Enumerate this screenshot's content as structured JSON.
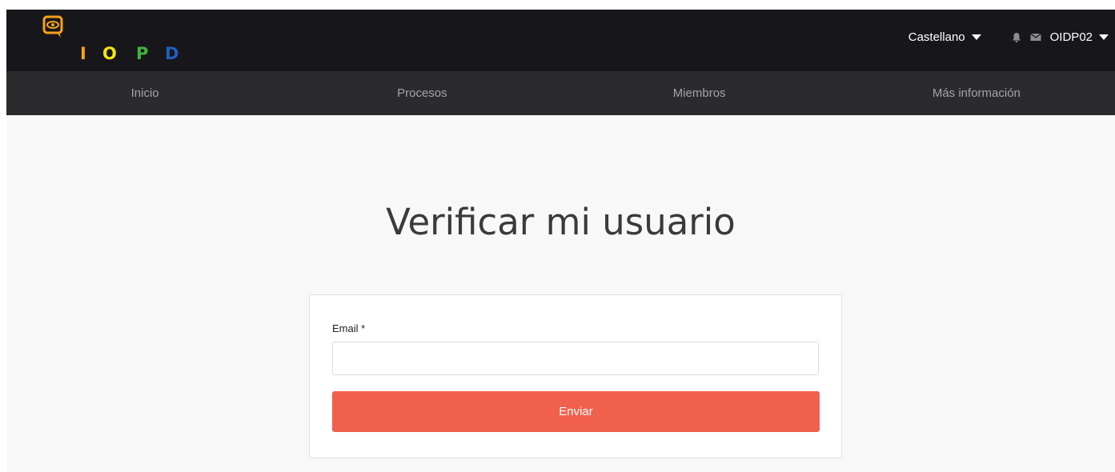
{
  "brand": {
    "letters": [
      "I",
      "O",
      "P",
      "D"
    ],
    "letter_colors": [
      "#f7a21b",
      "#f3e516",
      "#41b33b",
      "#1f5fbf"
    ],
    "icon": "eye-speech-bubble-icon",
    "icon_color": "#f7a21b"
  },
  "header": {
    "language": "Castellano",
    "notifications_icon": "bell-icon",
    "messages_icon": "envelope-icon",
    "username": "OIDP02"
  },
  "nav": {
    "items": [
      {
        "label": "Inicio"
      },
      {
        "label": "Procesos"
      },
      {
        "label": "Miembros"
      },
      {
        "label": "Más información"
      }
    ]
  },
  "main": {
    "title": "Verificar mi usuario",
    "form": {
      "email_label": "Email",
      "required_marker": "*",
      "email_value": "",
      "submit_label": "Enviar"
    }
  },
  "colors": {
    "topbar_bg": "#17171b",
    "navbar_bg": "#2b2b2e",
    "accent": "#f0604d",
    "page_bg": "#f8f8f8"
  }
}
